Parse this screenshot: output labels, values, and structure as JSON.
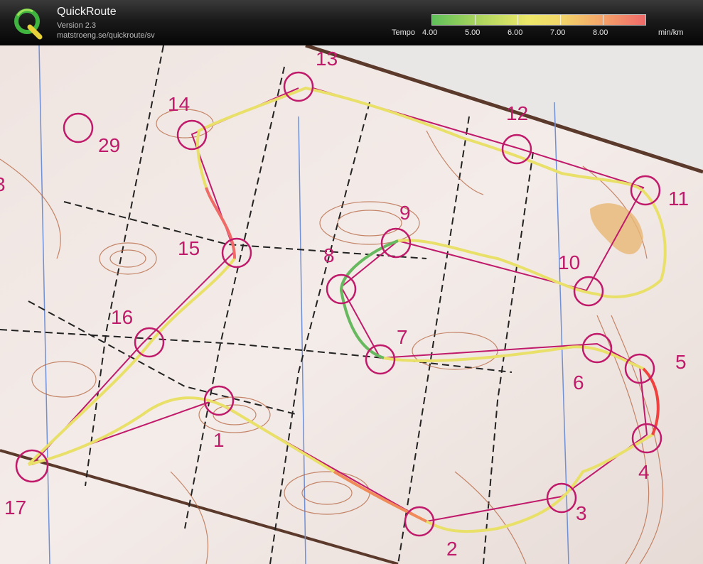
{
  "app": {
    "title": "QuickRoute",
    "version": "Version 2.3",
    "url": "matstroeng.se/quickroute/sv"
  },
  "legend": {
    "prefix": "Tempo",
    "unit": "min/km",
    "ticks": [
      "4.00",
      "5.00",
      "6.00",
      "7.00",
      "8.00"
    ],
    "colors": [
      "#5fc05a",
      "#ede86a",
      "#f06a6a"
    ]
  },
  "controls": [
    "1",
    "2",
    "3",
    "4",
    "5",
    "6",
    "7",
    "8",
    "9",
    "10",
    "11",
    "12",
    "13",
    "14",
    "15",
    "16",
    "17",
    "29",
    "3"
  ]
}
